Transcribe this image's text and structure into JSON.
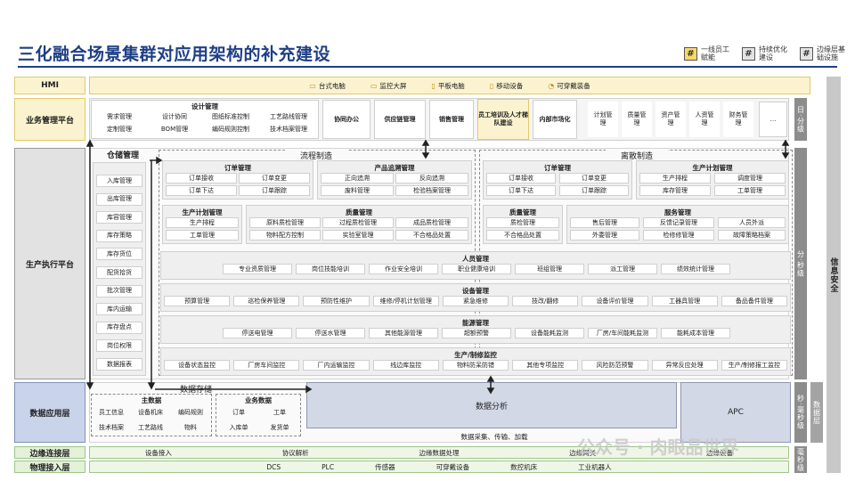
{
  "title": "三化融合场景集群对应用架构的补充建设",
  "legend": [
    {
      "mark": "#",
      "label": "一线员工赋能"
    },
    {
      "mark": "#",
      "label": "持续优化建设"
    },
    {
      "mark": "#",
      "label": "边缘层基础设施"
    }
  ],
  "rows": {
    "hmi": "HMI",
    "biz": "业务管理平台",
    "exec": "生产执行平台",
    "data": "数据应用层",
    "edge": "边缘连接层",
    "phys": "物理接入层"
  },
  "hmi_items": [
    "台式电脑",
    "监控大屏",
    "平板电脑",
    "移动设备",
    "可穿戴装备"
  ],
  "design": {
    "title": "设计管理",
    "items": [
      "需求管理",
      "设计协同",
      "图纸标准控制",
      "工艺路线管理",
      "定制管理",
      "BOM管理",
      "编码规则控制",
      "技术档案管理"
    ]
  },
  "biz_items": [
    "协同办公",
    "供应链管理",
    "销售管理",
    "员工培训及人才梯队建设",
    "内部市场化"
  ],
  "biz_small": [
    "计划管理",
    "质量管理",
    "资产管理",
    "人资管理",
    "财务管理",
    "…"
  ],
  "right_vbars": {
    "top": "日·分级",
    "exec": "分·秒级",
    "data": "秒·毫秒级",
    "edge": "毫秒级"
  },
  "far_right": "信息安全",
  "inner_vbars": {
    "gongye": "工·学",
    "jichuzhou": "边缘层",
    "zhongxin": "数据层"
  },
  "warehouse": {
    "title": "仓储管理",
    "items": [
      "入库管理",
      "出库管理",
      "库容管理",
      "库存策略",
      "库存货位",
      "配货拾货",
      "批次管理",
      "库内运输",
      "库存盘点",
      "岗位权限",
      "数据报表"
    ]
  },
  "flow": {
    "title": "流程制造",
    "order": {
      "title": "订单管理",
      "items": [
        "订单接收",
        "订单变更",
        "订单下达",
        "订单跟踪"
      ]
    },
    "trace": {
      "title": "产品追溯管理",
      "items": [
        "正向追溯",
        "反向追溯",
        "废料管理",
        "检验档案管理"
      ]
    },
    "plan": {
      "title": "生产计划管理",
      "items": [
        "生产排程",
        "工单管理"
      ]
    },
    "quality": {
      "title": "质量管理",
      "items": [
        "原料质检管理",
        "过程质检管理",
        "成品质检管理",
        "物料配方控制",
        "实验室管理",
        "不合格品处置"
      ]
    }
  },
  "discrete": {
    "title": "离散制造",
    "order": {
      "title": "订单管理",
      "items": [
        "订单接收",
        "订单变更",
        "订单下达",
        "订单跟踪"
      ]
    },
    "plan": {
      "title": "生产计划管理",
      "items": [
        "生产排程",
        "调度管理",
        "库存管理",
        "工单管理"
      ]
    },
    "quality": {
      "title": "质量管理",
      "items": [
        "质检管理",
        "不合格品处置"
      ]
    },
    "service": {
      "title": "服务管理",
      "items": [
        "售后管理",
        "反馈记录管理",
        "人员外派",
        "外委管理",
        "检修修管理",
        "故障策略档案"
      ]
    }
  },
  "people": {
    "title": "人员管理",
    "items": [
      "专业资质管理",
      "岗位技能培训",
      "作业安全培训",
      "职业健康培训",
      "班组管理",
      "派工管理",
      "绩效统计管理"
    ]
  },
  "equipment": {
    "title": "设备管理",
    "items": [
      "预算管理",
      "巡检保养管理",
      "预防性维护",
      "维修/停机计划管理",
      "紧急维修",
      "技改/翻修",
      "设备评价管理",
      "工器具管理",
      "备品备件管理"
    ]
  },
  "energy": {
    "title": "能源管理",
    "items": [
      "停送电管理",
      "停送水管理",
      "其他能源管理",
      "超额预警",
      "设备能耗监测",
      "厂房/车间能耗监测",
      "能耗成本管理"
    ]
  },
  "monitor": {
    "title": "生产/制修监控",
    "items": [
      "设备状态监控",
      "厂房车间监控",
      "厂内运输监控",
      "线边库监控",
      "物料防呆防错",
      "其他专项监控",
      "风险防范预警",
      "异常反应处理",
      "生产/制修报工监控"
    ]
  },
  "storage": {
    "title": "数据存储",
    "master": {
      "title": "主数据",
      "items": [
        "员工信息",
        "设备机床",
        "编码规则",
        "技术档案",
        "工艺路线",
        "物料"
      ]
    },
    "business": {
      "title": "业务数据",
      "items": [
        "订单",
        "工单",
        "入库单",
        "发货单"
      ]
    }
  },
  "analysis": "数据分析",
  "apc": "APC",
  "data_caption": "数据采集、传输、加载",
  "edge_items": [
    "设备接入",
    "协议解析",
    "边缘数据处理",
    "边缘网关",
    "边缘设备"
  ],
  "phys_items": [
    "DCS",
    "PLC",
    "传感器",
    "可穿戴设备",
    "数控机床",
    "工业机器人"
  ],
  "watermark": "公众号 · 肉眼品世界"
}
